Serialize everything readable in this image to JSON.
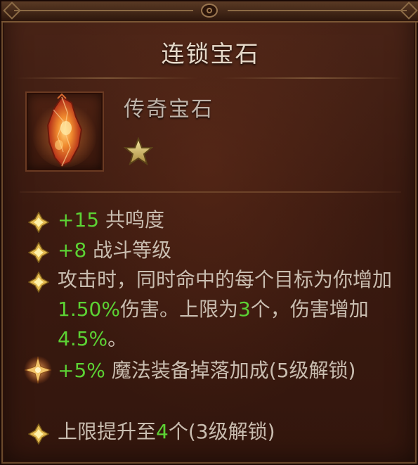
{
  "tooltip": {
    "title": "连锁宝石",
    "gem_type": "传奇宝石",
    "rank": "1-star",
    "icon": "legendary-gem-icon",
    "stats": [
      {
        "value": "+15",
        "label": " 共鸣度"
      },
      {
        "value": "+8",
        "label": " 战斗等级"
      }
    ],
    "effect": {
      "part1": "攻击时，同时命中的每个目标为你增加",
      "value1": "1.50%",
      "part2": "伤害。上限为",
      "value2": "3",
      "part3": "个，伤害增加",
      "value3": "4.5%",
      "part4": "。"
    },
    "bonus": {
      "value": "+5%",
      "label": " 魔法装备掉落加成(5级解锁)"
    },
    "upgrade": {
      "prefix": "上限提升至",
      "value": "4",
      "suffix": "个(3级解锁)"
    }
  },
  "colors": {
    "highlight": "#5cd234",
    "text": "#c9bdb0",
    "title": "#e6d9c9"
  }
}
